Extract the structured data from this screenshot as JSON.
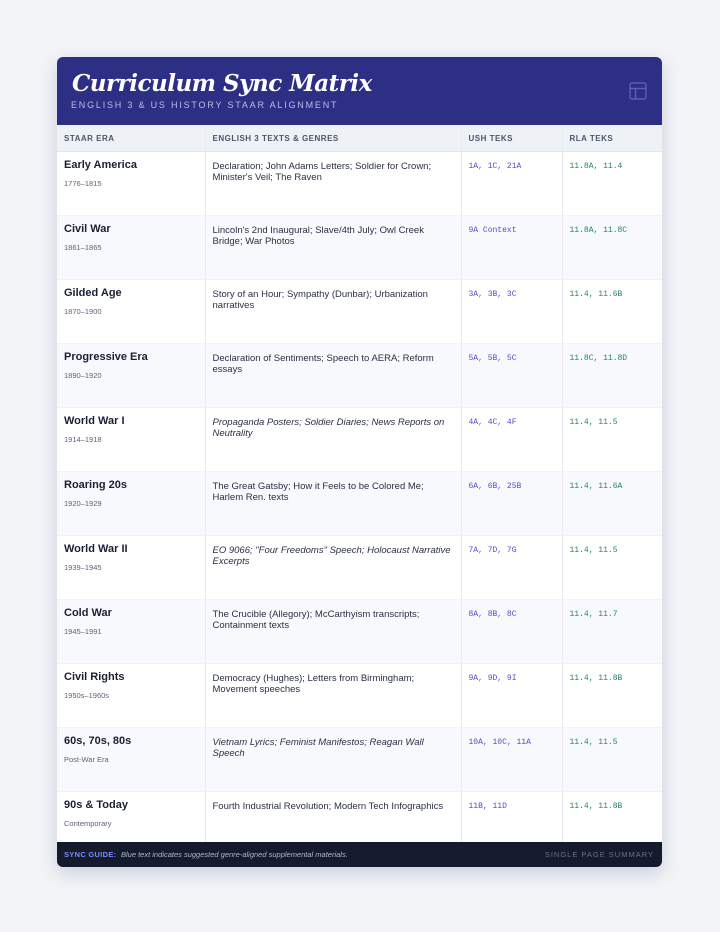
{
  "header": {
    "title": "Curriculum Sync Matrix",
    "subtitle": "ENGLISH 3 & US HISTORY STAAR ALIGNMENT"
  },
  "table": {
    "columns": [
      "STAAR ERA",
      "ENGLISH 3 TEXTS & GENRES",
      "USH TEKS",
      "RLA TEKS"
    ],
    "rows": [
      {
        "era": "Early America",
        "dates": "1776–1815",
        "texts": "Declaration; John Adams Letters; Soldier for Crown; Minister's Veil; The Raven",
        "italic": false,
        "ush": "1A, 1C, 21A",
        "rla": "11.8A, 11.4"
      },
      {
        "era": "Civil War",
        "dates": "1861–1865",
        "texts": "Lincoln's 2nd Inaugural; Slave/4th July; Owl Creek Bridge; War Photos",
        "italic": false,
        "ush": "9A Context",
        "rla": "11.8A, 11.8C"
      },
      {
        "era": "Gilded Age",
        "dates": "1870–1900",
        "texts": "Story of an Hour; Sympathy (Dunbar); Urbanization narratives",
        "italic": false,
        "ush": "3A, 3B, 3C",
        "rla": "11.4, 11.6B"
      },
      {
        "era": "Progressive Era",
        "dates": "1890–1920",
        "texts": "Declaration of Sentiments; Speech to AERA; Reform essays",
        "italic": false,
        "ush": "5A, 5B, 5C",
        "rla": "11.8C, 11.8D"
      },
      {
        "era": "World War I",
        "dates": "1914–1918",
        "texts": "Propaganda Posters; Soldier Diaries; News Reports on Neutrality",
        "italic": true,
        "ush": "4A, 4C, 4F",
        "rla": "11.4, 11.5"
      },
      {
        "era": "Roaring 20s",
        "dates": "1920–1929",
        "texts": "The Great Gatsby; How it Feels to be Colored Me; Harlem Ren. texts",
        "italic": false,
        "ush": "6A, 6B, 25B",
        "rla": "11.4, 11.6A"
      },
      {
        "era": "World War II",
        "dates": "1939–1945",
        "texts": "EO 9066; \"Four Freedoms\" Speech; Holocaust Narrative Excerpts",
        "italic": true,
        "ush": "7A, 7D, 7G",
        "rla": "11.4, 11.5"
      },
      {
        "era": "Cold War",
        "dates": "1945–1991",
        "texts": "The Crucible (Allegory); McCarthyism transcripts; Containment texts",
        "italic": false,
        "ush": "8A, 8B, 8C",
        "rla": "11.4, 11.7"
      },
      {
        "era": "Civil Rights",
        "dates": "1950s–1960s",
        "texts": "Democracy (Hughes); Letters from Birmingham; Movement speeches",
        "italic": false,
        "ush": "9A, 9D, 9I",
        "rla": "11.4, 11.8B"
      },
      {
        "era": "60s, 70s, 80s",
        "dates": "Post-War Era",
        "texts": "Vietnam Lyrics; Feminist Manifestos; Reagan Wall Speech",
        "italic": true,
        "ush": "10A, 10C, 11A",
        "rla": "11.4, 11.5"
      },
      {
        "era": "90s & Today",
        "dates": "Contemporary",
        "texts": "Fourth Industrial Revolution; Modern Tech Infographics",
        "italic": false,
        "ush": "11B, 11D",
        "rla": "11.4, 11.8B"
      }
    ]
  },
  "footer": {
    "label": "SYNC GUIDE:",
    "note": "Blue text indicates suggested genre-aligned supplemental materials.",
    "summary": "SINGLE PAGE SUMMARY"
  },
  "colors": {
    "header_bg": "#2d2f84",
    "ush_text": "#4a4fd4",
    "rla_text": "#1f8a55",
    "footer_bg": "#141b2d"
  },
  "icons": {
    "header": "table-layout-icon"
  }
}
